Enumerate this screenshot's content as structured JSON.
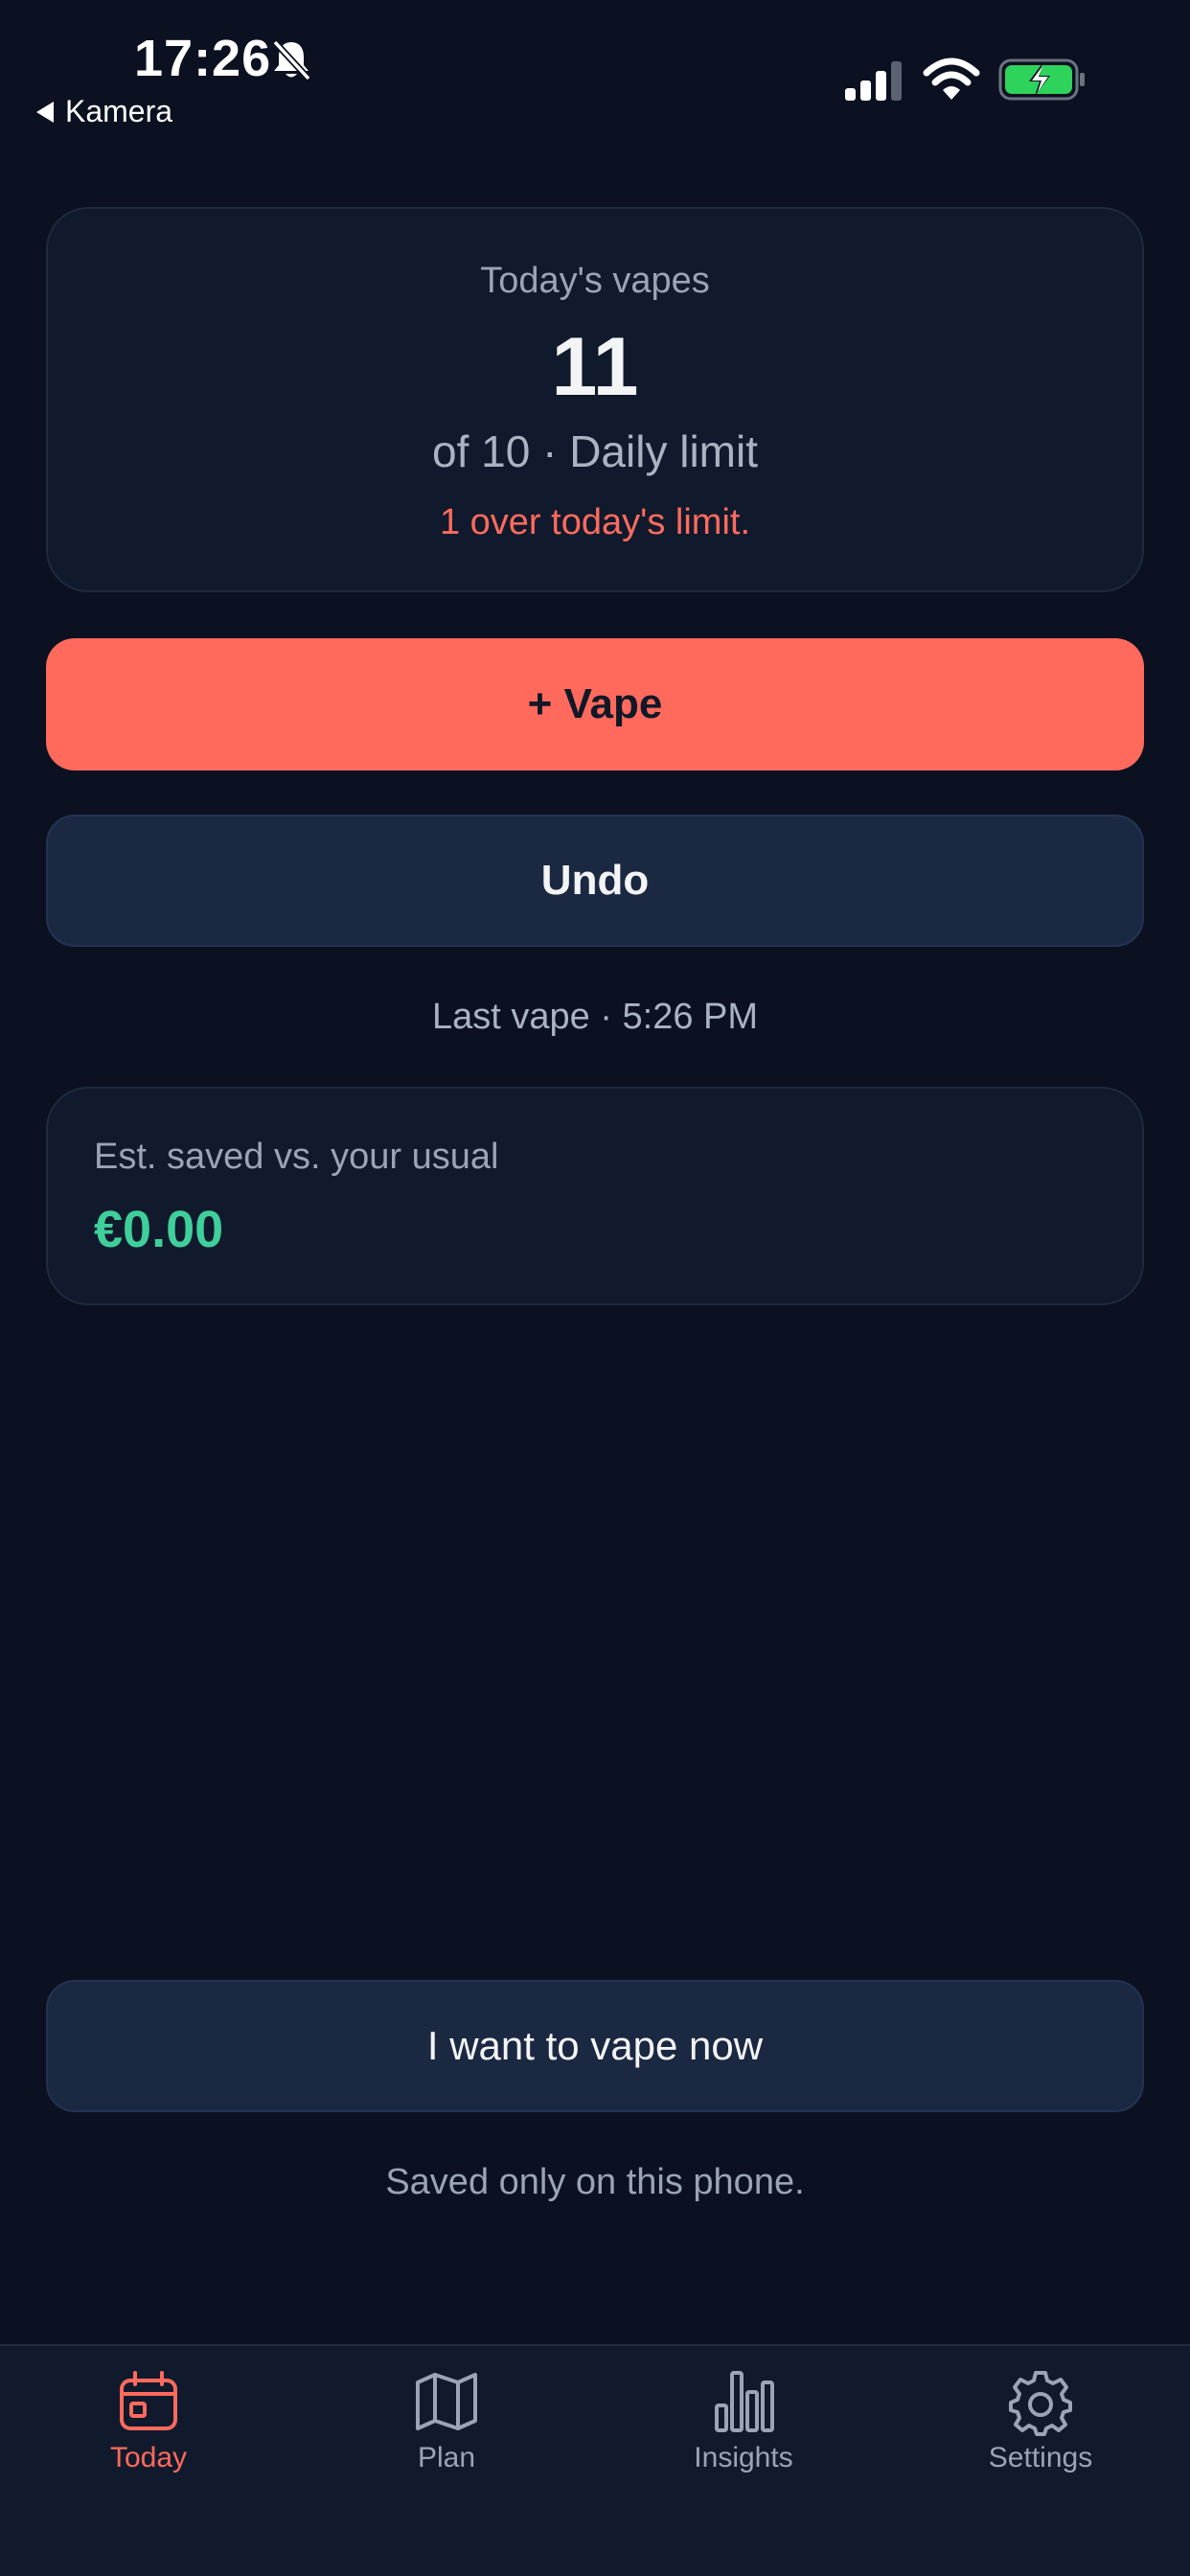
{
  "status_bar": {
    "time": "17:26",
    "back_label": "Kamera",
    "icons": [
      "bell-slash-icon",
      "cellular-signal-icon",
      "wifi-icon",
      "battery-charging-icon"
    ],
    "battery_color": "#2dd35a"
  },
  "today_card": {
    "title": "Today's vapes",
    "count": "11",
    "limit_text": "of 10 · Daily limit",
    "over_text": "1 over today's limit."
  },
  "actions": {
    "vape_label": "+ Vape",
    "undo_label": "Undo",
    "last_vape": "Last vape · 5:26 PM",
    "urge_label": "I want to vape now"
  },
  "savings": {
    "label": "Est. saved vs. your usual",
    "value": "€0.00"
  },
  "footer_note": "Saved only on this phone.",
  "tabs": [
    {
      "label": "Today",
      "icon": "calendar-icon",
      "active": true
    },
    {
      "label": "Plan",
      "icon": "map-icon",
      "active": false
    },
    {
      "label": "Insights",
      "icon": "bar-chart-icon",
      "active": false
    },
    {
      "label": "Settings",
      "icon": "gear-icon",
      "active": false
    }
  ],
  "colors": {
    "background": "#0b1120",
    "card": "#111a2c",
    "accent": "#ff6a5d",
    "danger_text": "#ff6b5e",
    "savings": "#3fcf9a"
  }
}
